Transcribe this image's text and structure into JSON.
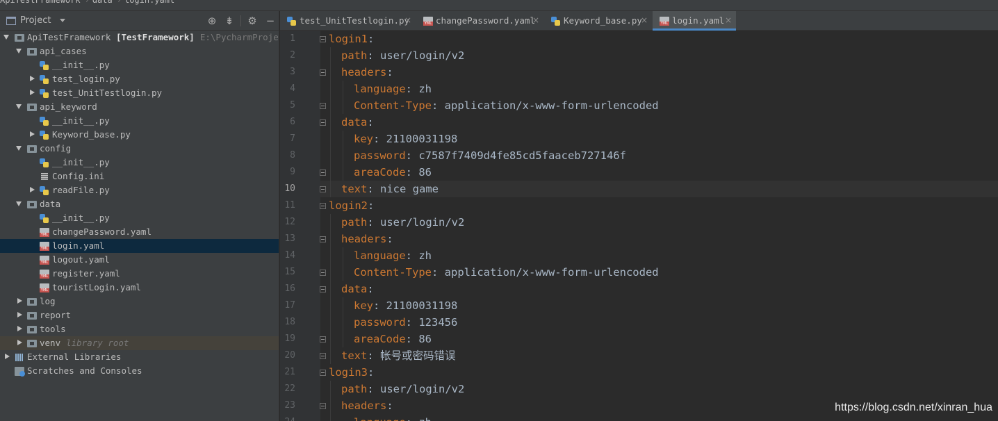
{
  "breadcrumb": [
    "ApiTestFramework",
    "data",
    "login.yaml"
  ],
  "panel": {
    "title": "Project",
    "icons": [
      "locate-icon",
      "collapse-icon",
      "gear-icon",
      "minimize-icon"
    ]
  },
  "tree": [
    {
      "label": "ApiTestFramework",
      "bold_suffix": "[TestFramework]",
      "suffix": "E:\\PycharmProjects\\",
      "icon": "folder",
      "arrow": "open",
      "depth": 0
    },
    {
      "label": "api_cases",
      "icon": "folder",
      "arrow": "open",
      "depth": 1
    },
    {
      "label": "__init__.py",
      "icon": "python",
      "arrow": "",
      "depth": 2
    },
    {
      "label": "test_login.py",
      "icon": "python",
      "arrow": "closed",
      "depth": 2
    },
    {
      "label": "test_UnitTestlogin.py",
      "icon": "python",
      "arrow": "closed",
      "depth": 2
    },
    {
      "label": "api_keyword",
      "icon": "folder",
      "arrow": "open",
      "depth": 1
    },
    {
      "label": "__init__.py",
      "icon": "python",
      "arrow": "",
      "depth": 2
    },
    {
      "label": "Keyword_base.py",
      "icon": "python",
      "arrow": "closed",
      "depth": 2
    },
    {
      "label": "config",
      "icon": "folder",
      "arrow": "open",
      "depth": 1
    },
    {
      "label": "__init__.py",
      "icon": "python",
      "arrow": "",
      "depth": 2
    },
    {
      "label": "Config.ini",
      "icon": "ini",
      "arrow": "",
      "depth": 2
    },
    {
      "label": "readFile.py",
      "icon": "python",
      "arrow": "closed",
      "depth": 2
    },
    {
      "label": "data",
      "icon": "folder",
      "arrow": "open",
      "depth": 1
    },
    {
      "label": "__init__.py",
      "icon": "python",
      "arrow": "",
      "depth": 2
    },
    {
      "label": "changePassword.yaml",
      "icon": "yaml",
      "arrow": "",
      "depth": 2
    },
    {
      "label": "login.yaml",
      "icon": "yaml",
      "arrow": "",
      "depth": 2,
      "selected": true
    },
    {
      "label": "logout.yaml",
      "icon": "yaml",
      "arrow": "",
      "depth": 2
    },
    {
      "label": "register.yaml",
      "icon": "yaml",
      "arrow": "",
      "depth": 2
    },
    {
      "label": "touristLogin.yaml",
      "icon": "yaml",
      "arrow": "",
      "depth": 2
    },
    {
      "label": "log",
      "icon": "folder",
      "arrow": "closed",
      "depth": 1
    },
    {
      "label": "report",
      "icon": "folder",
      "arrow": "closed",
      "depth": 1
    },
    {
      "label": "tools",
      "icon": "folder",
      "arrow": "closed",
      "depth": 1
    },
    {
      "label": "venv",
      "extra": "library root",
      "icon": "folder",
      "arrow": "closed",
      "depth": 1,
      "venv": true
    },
    {
      "label": "External Libraries",
      "icon": "libs",
      "arrow": "closed",
      "depth": 0
    },
    {
      "label": "Scratches and Consoles",
      "icon": "scratch",
      "arrow": "",
      "depth": 0
    }
  ],
  "tabs": [
    {
      "label": "test_UnitTestlogin.py",
      "icon": "python",
      "active": false
    },
    {
      "label": "changePassword.yaml",
      "icon": "yaml",
      "active": false
    },
    {
      "label": "Keyword_base.py",
      "icon": "python",
      "active": false
    },
    {
      "label": "login.yaml",
      "icon": "yaml",
      "active": true
    }
  ],
  "tab_close_glyph": "×",
  "editor": {
    "active_line": 10,
    "lines": [
      {
        "n": 1,
        "indent": 0,
        "key": "login1",
        "value": "",
        "fold": true
      },
      {
        "n": 2,
        "indent": 1,
        "key": "path",
        "value": "user/login/v2"
      },
      {
        "n": 3,
        "indent": 1,
        "key": "headers",
        "value": "",
        "fold": true
      },
      {
        "n": 4,
        "indent": 2,
        "key": "language",
        "value": "zh"
      },
      {
        "n": 5,
        "indent": 2,
        "key": "Content-Type",
        "value": "application/x-www-form-urlencoded",
        "fold": true
      },
      {
        "n": 6,
        "indent": 1,
        "key": "data",
        "value": "",
        "fold": true
      },
      {
        "n": 7,
        "indent": 2,
        "key": "key",
        "value": "21100031198"
      },
      {
        "n": 8,
        "indent": 2,
        "key": "password",
        "value": "c7587f7409d4fe85cd5faaceb727146f"
      },
      {
        "n": 9,
        "indent": 2,
        "key": "areaCode",
        "value": "86",
        "fold": true
      },
      {
        "n": 10,
        "indent": 1,
        "key": "text",
        "value": "nice game",
        "fold": true
      },
      {
        "n": 11,
        "indent": 0,
        "key": "login2",
        "value": "",
        "fold": true
      },
      {
        "n": 12,
        "indent": 1,
        "key": "path",
        "value": "user/login/v2"
      },
      {
        "n": 13,
        "indent": 1,
        "key": "headers",
        "value": "",
        "fold": true
      },
      {
        "n": 14,
        "indent": 2,
        "key": "language",
        "value": "zh"
      },
      {
        "n": 15,
        "indent": 2,
        "key": "Content-Type",
        "value": "application/x-www-form-urlencoded",
        "fold": true
      },
      {
        "n": 16,
        "indent": 1,
        "key": "data",
        "value": "",
        "fold": true
      },
      {
        "n": 17,
        "indent": 2,
        "key": "key",
        "value": "21100031198"
      },
      {
        "n": 18,
        "indent": 2,
        "key": "password",
        "value": "123456"
      },
      {
        "n": 19,
        "indent": 2,
        "key": "areaCode",
        "value": "86",
        "fold": true
      },
      {
        "n": 20,
        "indent": 1,
        "key": "text",
        "value": "帐号或密码错误",
        "fold": true
      },
      {
        "n": 21,
        "indent": 0,
        "key": "login3",
        "value": "",
        "fold": true
      },
      {
        "n": 22,
        "indent": 1,
        "key": "path",
        "value": "user/login/v2"
      },
      {
        "n": 23,
        "indent": 1,
        "key": "headers",
        "value": "",
        "fold": true
      },
      {
        "n": 24,
        "indent": 2,
        "key": "language",
        "value": "zh"
      }
    ]
  },
  "watermark": "https://blog.csdn.net/xinran_hua",
  "colors": {
    "key": "#cc7832",
    "value": "#a9b7c6",
    "selection": "#0d293e",
    "tab_underline": "#4a88c7"
  }
}
